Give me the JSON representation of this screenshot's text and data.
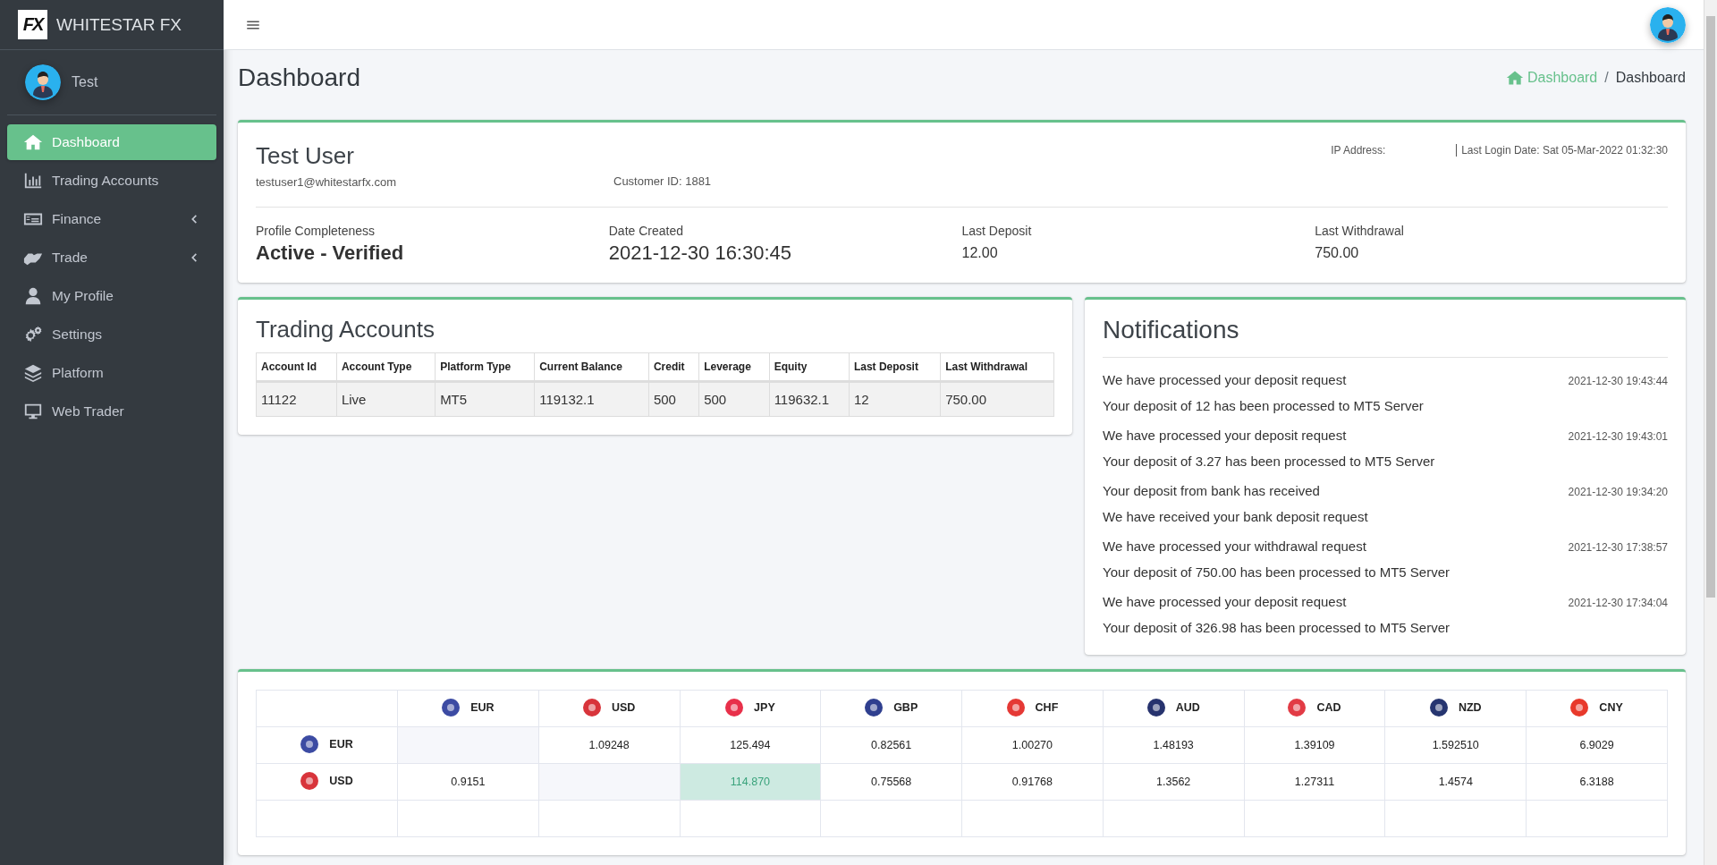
{
  "sidebar": {
    "logo": "FX",
    "brand": "WHITESTAR FX",
    "user": "Test",
    "items": [
      {
        "label": "Dashboard",
        "selected": true,
        "submenu": false
      },
      {
        "label": "Trading Accounts",
        "selected": false,
        "submenu": false
      },
      {
        "label": "Finance",
        "selected": false,
        "submenu": true
      },
      {
        "label": "Trade",
        "selected": false,
        "submenu": true
      },
      {
        "label": "My Profile",
        "selected": false,
        "submenu": false
      },
      {
        "label": "Settings",
        "selected": false,
        "submenu": false
      },
      {
        "label": "Platform",
        "selected": false,
        "submenu": false
      },
      {
        "label": "Web Trader",
        "selected": false,
        "submenu": false
      }
    ]
  },
  "page": {
    "title": "Dashboard",
    "breadcrumb": [
      "Dashboard",
      "Dashboard"
    ],
    "breadcrumb_separator": "/"
  },
  "profile": {
    "name": "Test User",
    "email": "testuser1@whitestarfx.com",
    "customer_id": "Customer ID: 1881",
    "ip_label": "IP Address:",
    "last_login": "Last Login Date: Sat 05-Mar-2022 01:32:30",
    "stats": [
      {
        "label": "Profile Completeness",
        "value": "Active - Verified",
        "kind": "strong"
      },
      {
        "label": "Date Created",
        "value": "2021-12-30 16:30:45",
        "kind": "large"
      },
      {
        "label": "Last Deposit",
        "value": "12.00",
        "kind": "plain"
      },
      {
        "label": "Last Withdrawal",
        "value": "750.00",
        "kind": "plain"
      }
    ]
  },
  "trading_accounts": {
    "title": "Trading Accounts",
    "columns": [
      "Account Id",
      "Account Type",
      "Platform Type",
      "Current Balance",
      "Credit",
      "Leverage",
      "Equity",
      "Last Deposit",
      "Last Withdrawal"
    ],
    "rows": [
      [
        "11122",
        "Live",
        "MT5",
        "119132.1",
        "500",
        "500",
        "119632.1",
        "12",
        "750.00"
      ]
    ]
  },
  "notifications": {
    "title": "Notifications",
    "items": [
      {
        "title": "We have processed your deposit request",
        "time": "2021-12-30 19:43:44",
        "message": "Your deposit of 12 has been processed to MT5 Server"
      },
      {
        "title": "We have processed your deposit request",
        "time": "2021-12-30 19:43:01",
        "message": "Your deposit of 3.27 has been processed to MT5 Server"
      },
      {
        "title": "Your deposit from bank has received",
        "time": "2021-12-30 19:34:20",
        "message": "We have received your bank deposit request"
      },
      {
        "title": "We have processed your withdrawal request",
        "time": "2021-12-30 17:38:57",
        "message": "Your deposit of 750.00 has been processed to MT5 Server"
      },
      {
        "title": "We have processed your deposit request",
        "time": "2021-12-30 17:34:04",
        "message": "Your deposit of 326.98 has been processed to MT5 Server"
      }
    ]
  },
  "rates": {
    "columns": [
      {
        "code": "EUR",
        "color": "#3c4ba3"
      },
      {
        "code": "USD",
        "color": "#d8343b"
      },
      {
        "code": "JPY",
        "color": "#e8304a"
      },
      {
        "code": "GBP",
        "color": "#2f3f8f"
      },
      {
        "code": "CHF",
        "color": "#e53935"
      },
      {
        "code": "AUD",
        "color": "#27336e"
      },
      {
        "code": "CAD",
        "color": "#e23b45"
      },
      {
        "code": "NZD",
        "color": "#263570"
      },
      {
        "code": "CNY",
        "color": "#e8392b"
      }
    ],
    "rows": [
      {
        "code": "EUR",
        "color": "#3c4ba3",
        "cells": [
          {
            "kind": "self"
          },
          {
            "kind": "rate",
            "value": "1.09248",
            "highlighted": false
          },
          {
            "kind": "rate",
            "value": "125.494",
            "highlighted": false
          },
          {
            "kind": "rate",
            "value": "0.82561",
            "highlighted": false
          },
          {
            "kind": "rate",
            "value": "1.00270",
            "highlighted": false
          },
          {
            "kind": "rate",
            "value": "1.48193",
            "highlighted": false
          },
          {
            "kind": "rate",
            "value": "1.39109",
            "highlighted": false
          },
          {
            "kind": "rate",
            "value": "1.592510",
            "highlighted": false
          },
          {
            "kind": "rate",
            "value": "6.9029",
            "highlighted": false
          }
        ]
      },
      {
        "code": "USD",
        "color": "#d8343b",
        "cells": [
          {
            "kind": "rate",
            "value": "0.9151",
            "highlighted": false
          },
          {
            "kind": "self"
          },
          {
            "kind": "rate",
            "value": "114.870",
            "highlighted": true
          },
          {
            "kind": "rate",
            "value": "0.75568",
            "highlighted": false
          },
          {
            "kind": "rate",
            "value": "0.91768",
            "highlighted": false
          },
          {
            "kind": "rate",
            "value": "1.3562",
            "highlighted": false
          },
          {
            "kind": "rate",
            "value": "1.27311",
            "highlighted": false
          },
          {
            "kind": "rate",
            "value": "1.4574",
            "highlighted": false
          },
          {
            "kind": "rate",
            "value": "6.3188",
            "highlighted": false
          }
        ]
      }
    ]
  }
}
